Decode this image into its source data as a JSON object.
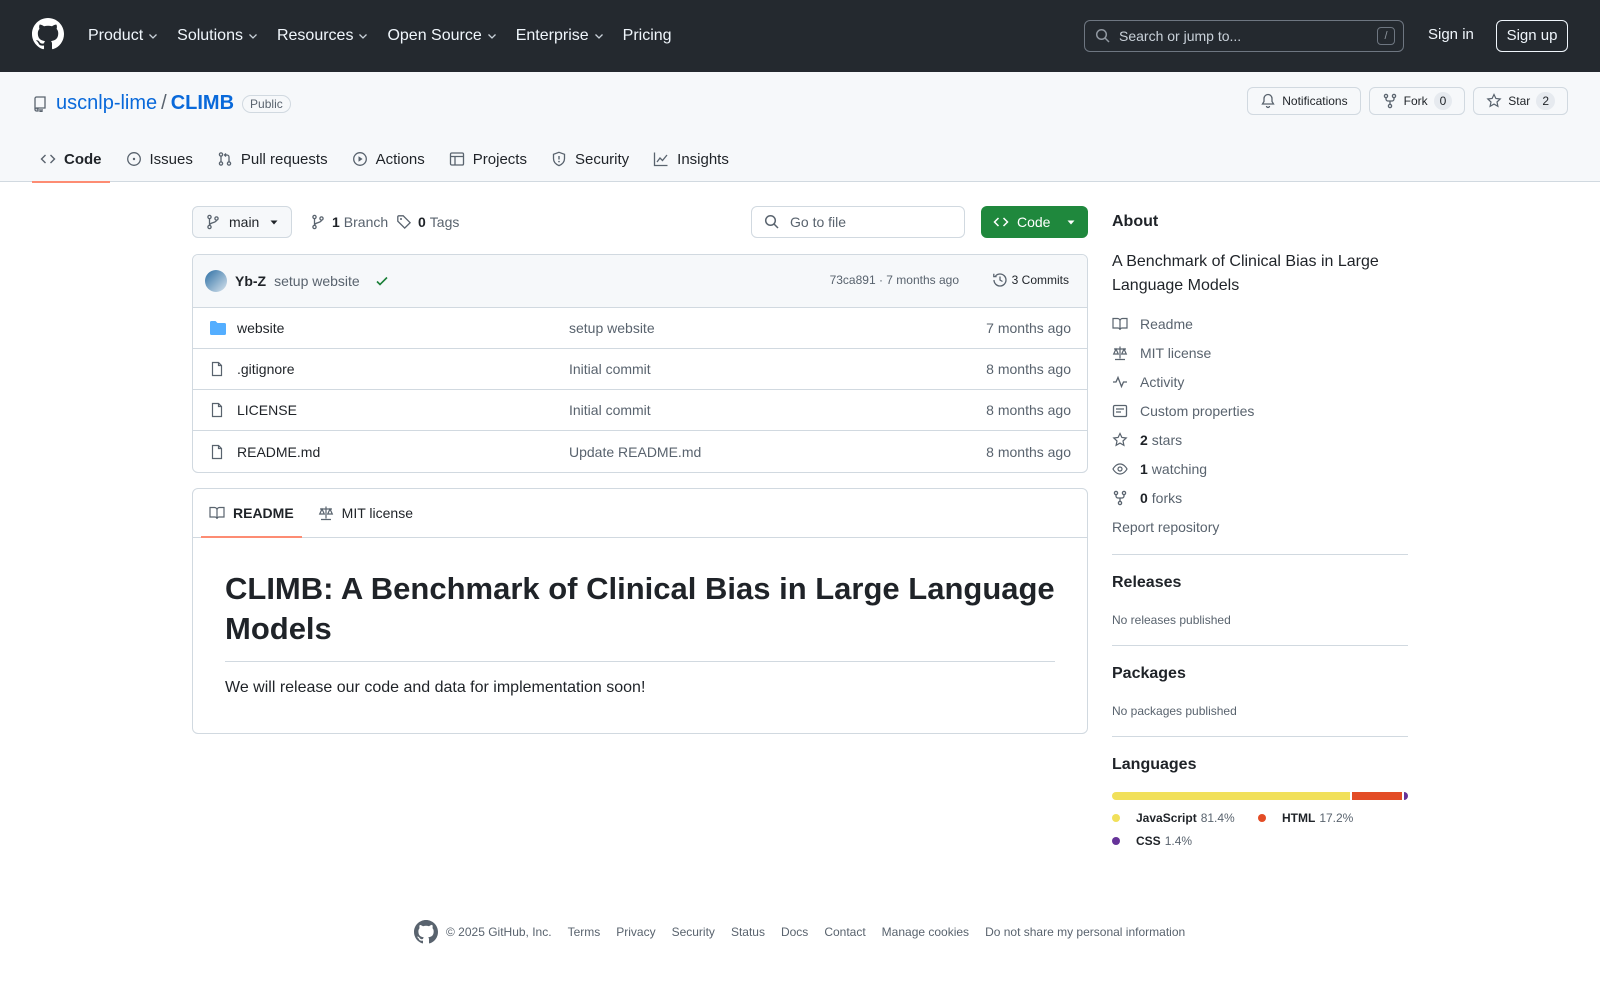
{
  "header": {
    "nav": [
      {
        "label": "Product",
        "has_menu": true
      },
      {
        "label": "Solutions",
        "has_menu": true
      },
      {
        "label": "Resources",
        "has_menu": true
      },
      {
        "label": "Open Source",
        "has_menu": true
      },
      {
        "label": "Enterprise",
        "has_menu": true
      },
      {
        "label": "Pricing",
        "has_menu": false
      }
    ],
    "search_placeholder": "Search or jump to...",
    "search_shortcut": "/",
    "sign_in": "Sign in",
    "sign_up": "Sign up"
  },
  "repo": {
    "owner": "uscnlp-lime",
    "separator": "/",
    "name": "CLIMB",
    "visibility": "Public",
    "notifications_label": "Notifications",
    "fork_label": "Fork",
    "fork_count": "0",
    "star_label": "Star",
    "star_count": "2",
    "tabs": [
      {
        "label": "Code",
        "icon": "code-icon",
        "active": true
      },
      {
        "label": "Issues",
        "icon": "issue-icon"
      },
      {
        "label": "Pull requests",
        "icon": "pull-request-icon"
      },
      {
        "label": "Actions",
        "icon": "play-icon"
      },
      {
        "label": "Projects",
        "icon": "table-icon"
      },
      {
        "label": "Security",
        "icon": "shield-icon"
      },
      {
        "label": "Insights",
        "icon": "graph-icon"
      }
    ]
  },
  "toolbar": {
    "branch": "main",
    "branch_count": "1",
    "branch_label": "Branch",
    "tag_count": "0",
    "tag_label": "Tags",
    "goto_placeholder": "Go to file",
    "code_button": "Code"
  },
  "commit": {
    "author": "Yb-Z",
    "message": "setup website",
    "status": "success",
    "hash_time": "73ca891 · 7 months ago",
    "commits_label": "3 Commits"
  },
  "files": [
    {
      "name": "website",
      "type": "folder",
      "message": "setup website",
      "time": "7 months ago"
    },
    {
      "name": ".gitignore",
      "type": "file",
      "message": "Initial commit",
      "time": "8 months ago"
    },
    {
      "name": "LICENSE",
      "type": "file",
      "message": "Initial commit",
      "time": "8 months ago"
    },
    {
      "name": "README.md",
      "type": "file",
      "message": "Update README.md",
      "time": "8 months ago"
    }
  ],
  "readme": {
    "tab_readme": "README",
    "tab_license": "MIT license",
    "heading": "CLIMB: A Benchmark of Clinical Bias in Large Language Models",
    "body": "We will release our code and data for implementation soon!"
  },
  "sidebar": {
    "about_title": "About",
    "description": "A Benchmark of Clinical Bias in Large Language Models",
    "readme": "Readme",
    "license": "MIT license",
    "activity": "Activity",
    "custom_properties": "Custom properties",
    "stars_count": "2",
    "stars_label": "stars",
    "watching_count": "1",
    "watching_label": "watching",
    "forks_count": "0",
    "forks_label": "forks",
    "report": "Report repository",
    "releases_title": "Releases",
    "releases_empty": "No releases published",
    "packages_title": "Packages",
    "packages_empty": "No packages published",
    "languages_title": "Languages",
    "languages": [
      {
        "name": "JavaScript",
        "percent": "81.4%",
        "value": 81.4,
        "color": "#f1e05a"
      },
      {
        "name": "HTML",
        "percent": "17.2%",
        "value": 17.2,
        "color": "#e34c26"
      },
      {
        "name": "CSS",
        "percent": "1.4%",
        "value": 1.4,
        "color": "#663399"
      }
    ]
  },
  "footer": {
    "copyright": "© 2025 GitHub, Inc.",
    "links": [
      "Terms",
      "Privacy",
      "Security",
      "Status",
      "Docs",
      "Contact",
      "Manage cookies",
      "Do not share my personal information"
    ]
  }
}
